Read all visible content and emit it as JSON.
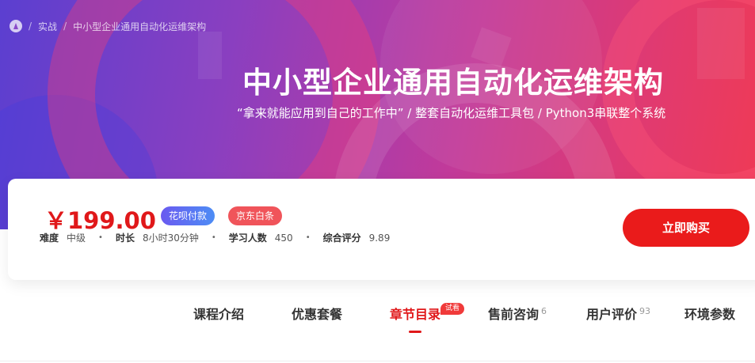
{
  "breadcrumb": {
    "items": [
      "实战",
      "中小型企业通用自动化运维架构"
    ]
  },
  "course": {
    "title": "中小型企业通用自动化运维架构",
    "subtitle": "“拿来就能应用到自己的工作中” / 整套自动化运维工具包 / Python3串联整个系统"
  },
  "purchase": {
    "price": "￥199.00",
    "badges": [
      "花呗付款",
      "京东白条"
    ],
    "meta": [
      {
        "label": "难度",
        "value": "中级"
      },
      {
        "label": "时长",
        "value": "8小时30分钟"
      },
      {
        "label": "学习人数",
        "value": "450"
      },
      {
        "label": "综合评分",
        "value": "9.89"
      }
    ],
    "buy_label": "立即购买"
  },
  "tabs": [
    {
      "label": "课程介绍",
      "count": ""
    },
    {
      "label": "优惠套餐",
      "count": ""
    },
    {
      "label": "章节目录",
      "count": "",
      "active": true,
      "tag": "试看"
    },
    {
      "label": "售前咨询",
      "count": "6"
    },
    {
      "label": "用户评价",
      "count": "93"
    },
    {
      "label": "环境参数",
      "count": ""
    }
  ],
  "colors": {
    "accent": "#e0181a",
    "buy_button": "#ea1b1b",
    "huabei_badge": "#6a5af0",
    "jd_badge": "#f0545a"
  },
  "icons": {
    "home": "home-logo-icon"
  }
}
